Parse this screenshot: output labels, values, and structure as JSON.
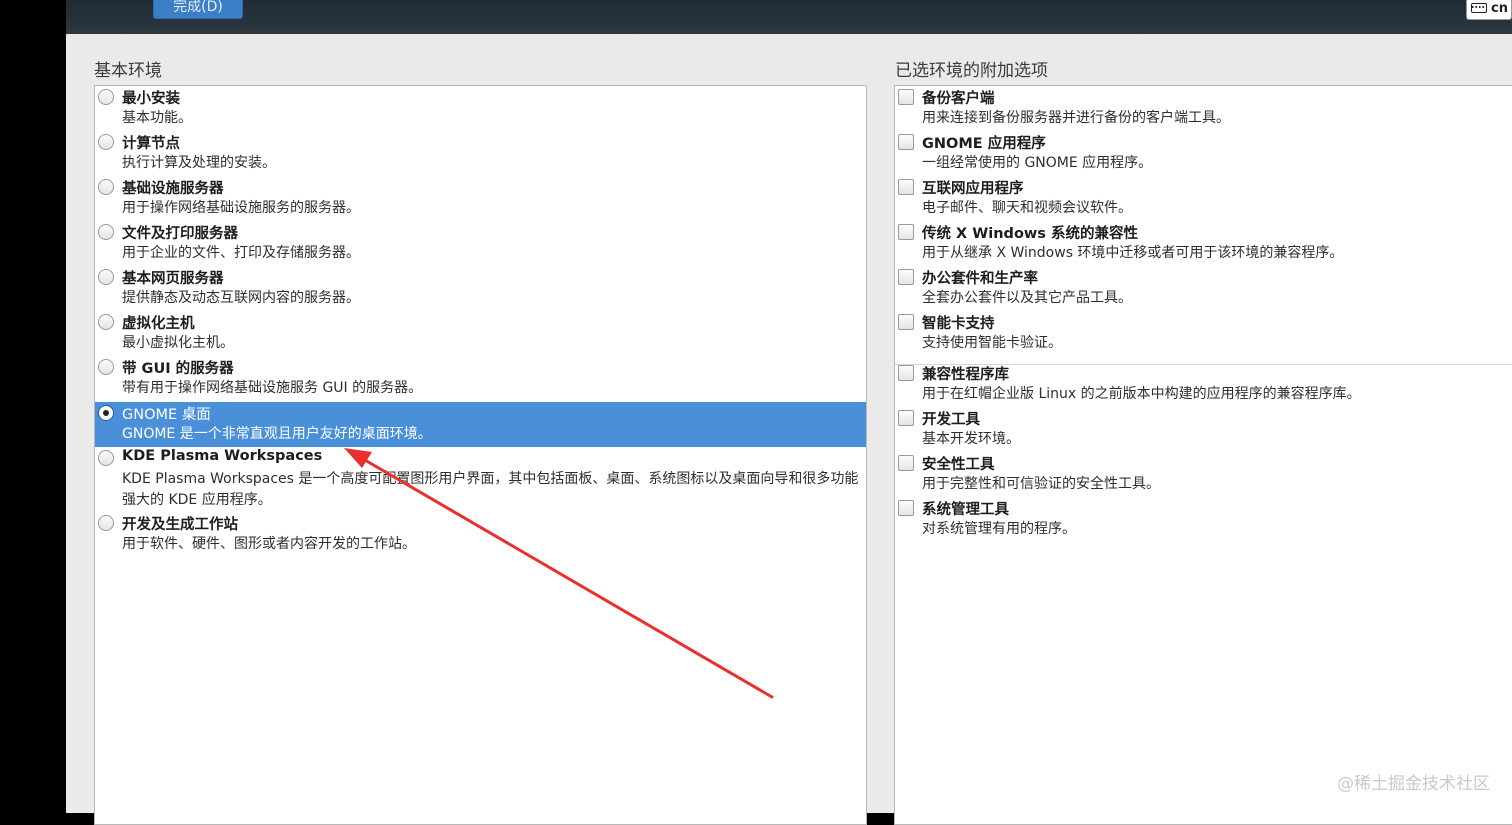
{
  "header": {
    "done_button": "完成(D)",
    "keyboard_label": "cn"
  },
  "base_env": {
    "title": "基本环境",
    "items": [
      {
        "label": "最小安装",
        "desc": "基本功能。"
      },
      {
        "label": "计算节点",
        "desc": "执行计算及处理的安装。"
      },
      {
        "label": "基础设施服务器",
        "desc": "用于操作网络基础设施服务的服务器。"
      },
      {
        "label": "文件及打印服务器",
        "desc": "用于企业的文件、打印及存储服务器。"
      },
      {
        "label": "基本网页服务器",
        "desc": "提供静态及动态互联网内容的服务器。"
      },
      {
        "label": "虚拟化主机",
        "desc": "最小虚拟化主机。"
      },
      {
        "label": "带 GUI 的服务器",
        "desc": "带有用于操作网络基础设施服务 GUI 的服务器。"
      },
      {
        "label": "GNOME 桌面",
        "desc": "GNOME 是一个非常直观且用户友好的桌面环境。"
      },
      {
        "label": "KDE Plasma Workspaces",
        "desc": "KDE Plasma Workspaces 是一个高度可配置图形用户界面，其中包括面板、桌面、系统图标以及桌面向导和很多功能强大的 KDE 应用程序。"
      },
      {
        "label": "开发及生成工作站",
        "desc": "用于软件、硬件、图形或者内容开发的工作站。"
      }
    ],
    "selected_index": 7
  },
  "addons": {
    "title": "已选环境的附加选项",
    "items": [
      {
        "label": "备份客户端",
        "desc": "用来连接到备份服务器并进行备份的客户端工具。"
      },
      {
        "label": "GNOME 应用程序",
        "desc": "一组经常使用的 GNOME 应用程序。"
      },
      {
        "label": "互联网应用程序",
        "desc": "电子邮件、聊天和视频会议软件。"
      },
      {
        "label": "传统 X Windows 系统的兼容性",
        "desc": "用于从继承 X Windows 环境中迁移或者可用于该环境的兼容程序。"
      },
      {
        "label": "办公套件和生产率",
        "desc": "全套办公套件以及其它产品工具。"
      },
      {
        "label": "智能卡支持",
        "desc": "支持使用智能卡验证。"
      },
      {
        "label": "兼容性程序库",
        "desc": "用于在红帽企业版 Linux 的之前版本中构建的应用程序的兼容程序库。"
      },
      {
        "label": "开发工具",
        "desc": "基本开发环境。"
      },
      {
        "label": "安全性工具",
        "desc": "用于完整性和可信验证的安全性工具。"
      },
      {
        "label": "系统管理工具",
        "desc": "对系统管理有用的程序。"
      }
    ]
  },
  "watermark": "@稀土掘金技术社区",
  "colors": {
    "selection": "#4a90d9",
    "annotation_arrow": "#e8302c"
  }
}
